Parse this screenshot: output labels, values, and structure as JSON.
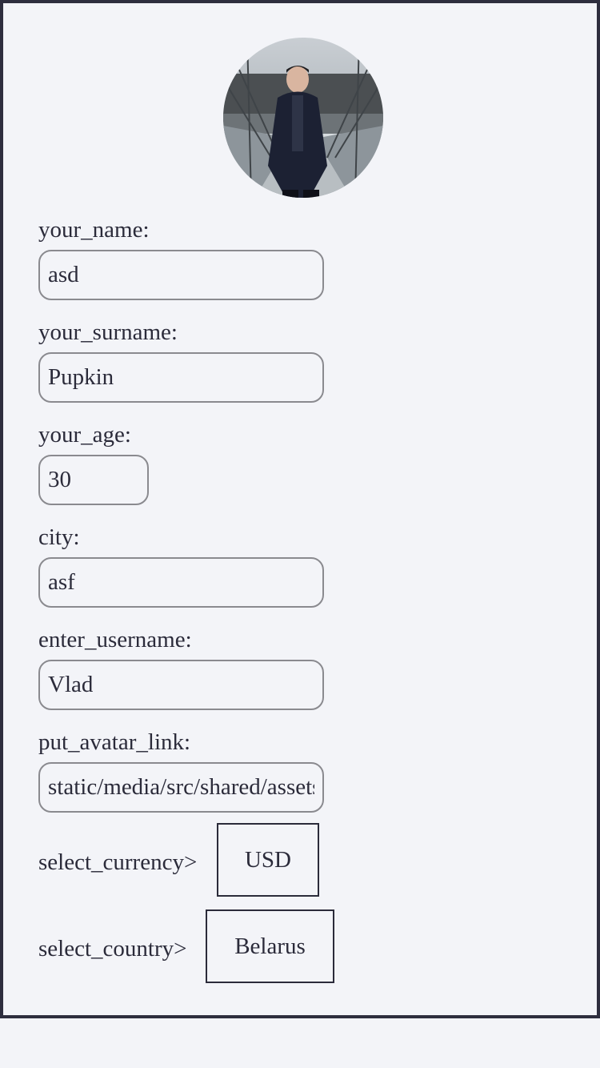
{
  "profile": {
    "avatar_alt": "avatar-photo"
  },
  "fields": [
    {
      "label": "your_name:",
      "value": "asd"
    },
    {
      "label": "your_surname:",
      "value": "Pupkin"
    },
    {
      "label": "your_age:",
      "value": "30"
    },
    {
      "label": "city:",
      "value": "asf"
    },
    {
      "label": "enter_username:",
      "value": "Vlad"
    },
    {
      "label": "put_avatar_link:",
      "value": "static/media/src/shared/assets/avatar.jpg"
    }
  ],
  "currency": {
    "label": "select_currency>",
    "selected": "USD"
  },
  "country": {
    "label": "select_country>",
    "selected": "Belarus"
  }
}
